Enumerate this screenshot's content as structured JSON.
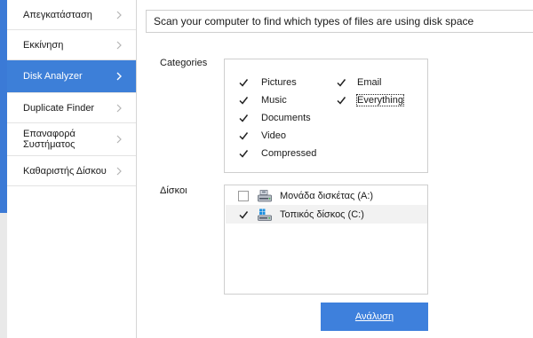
{
  "sidebar": {
    "items": [
      {
        "label": "Απεγκατάσταση",
        "active": false
      },
      {
        "label": "Εκκίνηση",
        "active": false
      },
      {
        "label": "Disk Analyzer",
        "active": true
      },
      {
        "label": "Duplicate Finder",
        "active": false
      },
      {
        "label": "Επαναφορά\nΣυστήματος",
        "active": false
      },
      {
        "label": "Καθαριστής Δίσκου",
        "active": false
      }
    ]
  },
  "header": {
    "description": "Scan your computer to find which types of files are using disk space"
  },
  "categories": {
    "section_label": "Categories",
    "items": [
      {
        "label": "Pictures",
        "checked": true
      },
      {
        "label": "Music",
        "checked": true
      },
      {
        "label": "Documents",
        "checked": true
      },
      {
        "label": "Video",
        "checked": true
      },
      {
        "label": "Compressed",
        "checked": true
      },
      {
        "label": "Email",
        "checked": true
      },
      {
        "label": "Everything",
        "checked": true,
        "focused": true
      }
    ]
  },
  "disks": {
    "section_label": "Δίσκοι",
    "items": [
      {
        "label": "Μονάδα δισκέτας (A:)",
        "checked": false,
        "icon": "floppy-drive-icon"
      },
      {
        "label": "Τοπικός δίσκος (C:)",
        "checked": true,
        "icon": "local-disk-icon"
      }
    ]
  },
  "actions": {
    "analyze_label": "Ανάλυση"
  },
  "colors": {
    "accent": "#3d7fd8",
    "border": "#cfcfcf"
  }
}
